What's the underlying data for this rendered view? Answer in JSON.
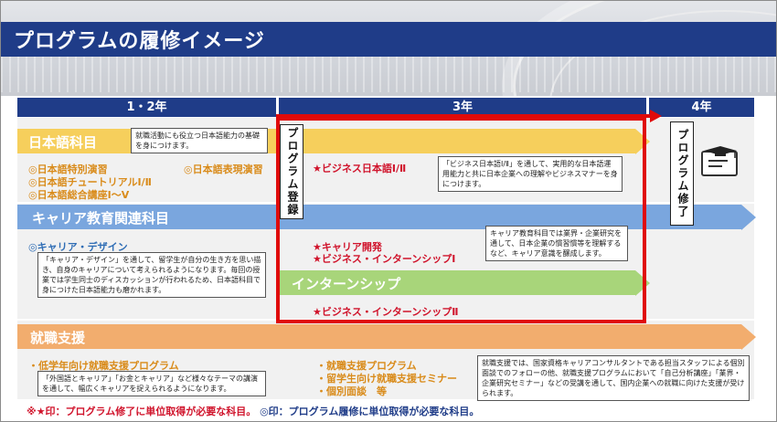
{
  "title": "プログラムの履修イメージ",
  "years": [
    "1・2年",
    "3年",
    "4年"
  ],
  "japanese": {
    "label": "日本語科目",
    "note": "就職活動にも役立つ日本語能力の基礎を身につけます。",
    "items": [
      "日本語特別演習",
      "日本語チュートリアルⅠ/Ⅱ",
      "日本語総合講座Ⅰ～Ⅴ"
    ],
    "item_extra": "日本語表現演習",
    "y3_item": "★ビジネス日本語Ⅰ/Ⅱ",
    "y3_note": "「ビジネス日本語Ⅰ/Ⅱ」を通して、実用的な日本語運用能力と共に日本企業への理解やビジネスマナーを身につけます。"
  },
  "career": {
    "label": "キャリア教育関連科目",
    "item": "◎キャリア・デザイン",
    "note": "「キャリア・デザイン」を通して、留学生が自分の生き方を思い描き、自身のキャリアについて考えられるようになります。毎回の授業では学生同士のディスカッションが行われるため、日本語科目で身につけた日本語能力も磨かれます。",
    "y3_items": [
      "★キャリア開発",
      "★ビジネス・インターンシップⅠ"
    ],
    "y3_note": "キャリア教育科目では業界・企業研究を通して、日本企業の慣習慣等を理解するなど、キャリア意識を醸成します。"
  },
  "internship": {
    "label": "インターンシップ",
    "item": "★ビジネス・インターンシップⅡ"
  },
  "job": {
    "label": "就職支援",
    "item": "・低学年向け就職支援プログラム",
    "note": "「外国語とキャリア」「お金とキャリア」など様々なテーマの講演を通して、幅広くキャリアを捉えられるようになります。",
    "y3_items": [
      "・就職支援プログラム",
      "・留学生向け就職支援セミナー",
      "・個別面談　等"
    ],
    "y3_note": "就職支援では、国家資格キャリアコンサルタントである担当スタッフによる個別面談でのフォローの他、就職支援プログラムにおいて「自己分析講座」「業界・企業研究セミナー」などの受講を通して、国内企業への就職に向けた支援が受けられます。"
  },
  "registration": "プログラム登録",
  "completion": "プログラム修了",
  "footer": {
    "star": "※★印：プログラム修了に単位取得が必要な科目。",
    "circle": "◎印：プログラム履修に単位取得が必要な科目。"
  },
  "colors": {
    "navy": "#1f3c88",
    "yellow": "#f6cf5c",
    "blue": "#7aa6de",
    "green": "#a8d57a",
    "orange": "#f2ad6e",
    "red": "#e00a0a"
  }
}
